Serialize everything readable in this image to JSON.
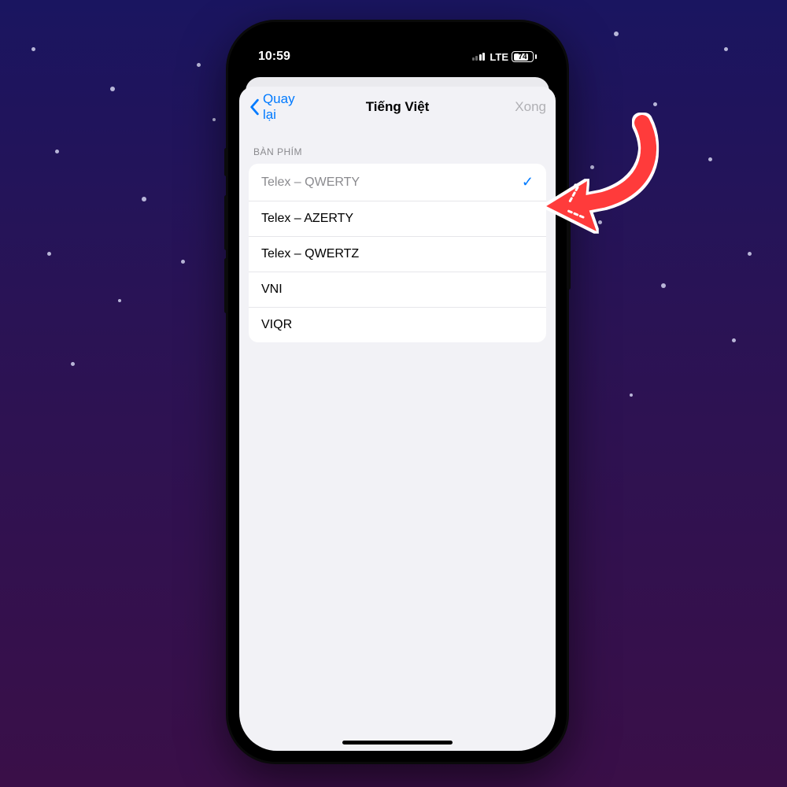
{
  "statusbar": {
    "time": "10:59",
    "network": "LTE",
    "battery_pct": "74"
  },
  "nav": {
    "back_label": "Quay lại",
    "title": "Tiếng Việt",
    "done_label": "Xong"
  },
  "section_header": "BÀN PHÍM",
  "keyboards": [
    {
      "label": "Telex – QWERTY",
      "selected": true
    },
    {
      "label": "Telex – AZERTY",
      "selected": false
    },
    {
      "label": "Telex – QWERTZ",
      "selected": false
    },
    {
      "label": "VNI",
      "selected": false
    },
    {
      "label": "VIQR",
      "selected": false
    }
  ]
}
